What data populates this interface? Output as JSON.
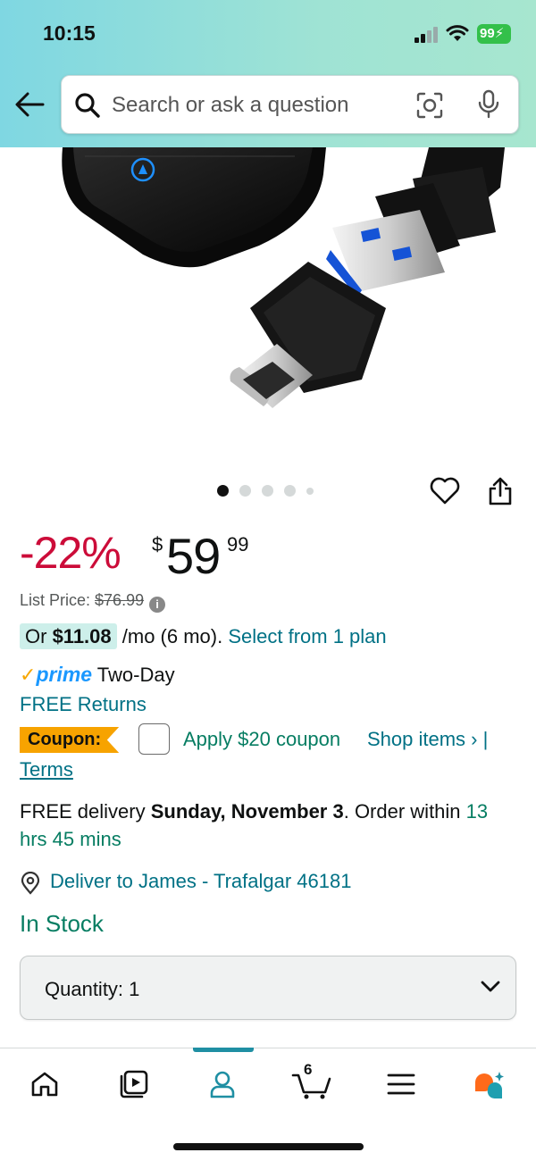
{
  "status_bar": {
    "time": "10:15",
    "battery": "99"
  },
  "search": {
    "placeholder": "Search or ask a question"
  },
  "carousel": {
    "total_dots": 5,
    "active_index": 0
  },
  "price": {
    "discount": "-22%",
    "currency_symbol": "$",
    "whole": "59",
    "fraction": "99",
    "list_price_label": "List Price: ",
    "list_price": "$76.99"
  },
  "monthly": {
    "prefix": "Or ",
    "amount": "$11.08",
    "suffix": " /mo (6 mo). ",
    "link": "Select from 1 plan"
  },
  "shipping": {
    "prime_check": "✓",
    "prime_label": "prime",
    "speed": " Two-Day",
    "returns": "FREE Returns"
  },
  "coupon": {
    "badge": "Coupon:",
    "apply": "Apply $20 coupon",
    "shop": "Shop items › |",
    "terms": "Terms"
  },
  "delivery": {
    "prefix": "FREE delivery ",
    "date": "Sunday, November 3",
    "middle": ". Order within ",
    "countdown": "13 hrs 45 mins"
  },
  "deliver_to": "Deliver to James - Trafalgar 46181",
  "stock": "In Stock",
  "quantity": {
    "label": "Quantity: ",
    "value": "1"
  },
  "bottom_nav": {
    "active": "profile",
    "cart_count": "6"
  },
  "colors": {
    "discount": "#cc0c39",
    "link": "#007185",
    "green": "#067d62",
    "coupon_badge": "#f7a300",
    "prime_blue": "#1a98ff",
    "nav_active": "#1f8fa3"
  }
}
